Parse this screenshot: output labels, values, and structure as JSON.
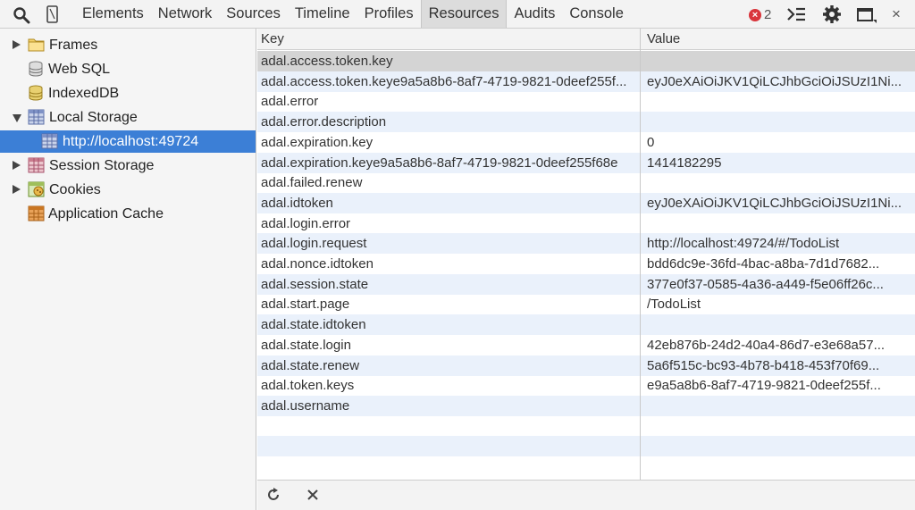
{
  "toolbar": {
    "tabs": [
      "Elements",
      "Network",
      "Sources",
      "Timeline",
      "Profiles",
      "Resources",
      "Audits",
      "Console"
    ],
    "selected_tab": "Resources",
    "error_count": "2",
    "close_glyph": "×"
  },
  "sidebar": {
    "frames": "Frames",
    "web_sql": "Web SQL",
    "indexeddb": "IndexedDB",
    "local_storage": "Local Storage",
    "local_storage_origin": "http://localhost:49724",
    "session_storage": "Session Storage",
    "cookies": "Cookies",
    "application_cache": "Application Cache"
  },
  "table": {
    "key_header": "Key",
    "value_header": "Value",
    "rows": [
      {
        "key": "adal.access.token.key",
        "value": ""
      },
      {
        "key": "adal.access.token.keye9a5a8b6-8af7-4719-9821-0deef255f...",
        "value": "eyJ0eXAiOiJKV1QiLCJhbGciOiJSUzI1Ni..."
      },
      {
        "key": "adal.error",
        "value": ""
      },
      {
        "key": "adal.error.description",
        "value": ""
      },
      {
        "key": "adal.expiration.key",
        "value": "0"
      },
      {
        "key": "adal.expiration.keye9a5a8b6-8af7-4719-9821-0deef255f68e",
        "value": "1414182295"
      },
      {
        "key": "adal.failed.renew",
        "value": ""
      },
      {
        "key": "adal.idtoken",
        "value": "eyJ0eXAiOiJKV1QiLCJhbGciOiJSUzI1Ni..."
      },
      {
        "key": "adal.login.error",
        "value": ""
      },
      {
        "key": "adal.login.request",
        "value": "http://localhost:49724/#/TodoList"
      },
      {
        "key": "adal.nonce.idtoken",
        "value": "bdd6dc9e-36fd-4bac-a8ba-7d1d7682..."
      },
      {
        "key": "adal.session.state",
        "value": "377e0f37-0585-4a36-a449-f5e06ff26c..."
      },
      {
        "key": "adal.start.page",
        "value": "/TodoList"
      },
      {
        "key": "adal.state.idtoken",
        "value": ""
      },
      {
        "key": "adal.state.login",
        "value": "42eb876b-24d2-40a4-86d7-e3e68a57..."
      },
      {
        "key": "adal.state.renew",
        "value": "5a6f515c-bc93-4b78-b418-453f70f69..."
      },
      {
        "key": "adal.token.keys",
        "value": "e9a5a8b6-8af7-4719-9821-0deef255f..."
      },
      {
        "key": "adal.username",
        "value": ""
      }
    ]
  },
  "bottombar": {
    "refresh_icon": "refresh-icon",
    "delete_icon": "close-icon"
  }
}
